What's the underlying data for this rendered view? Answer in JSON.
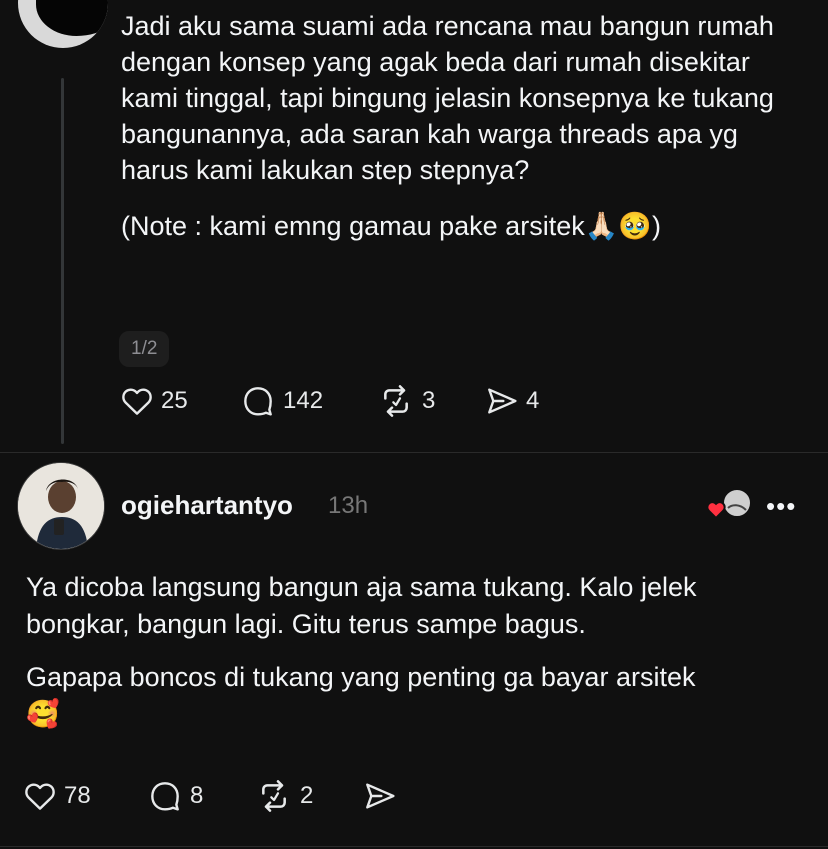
{
  "original_post": {
    "paragraph_1": "Jadi aku sama suami ada rencana mau bangun rumah dengan konsep yang agak beda dari rumah disekitar kami tinggal, tapi bingung jelasin konsepnya ke tukang bangunannya, ada saran kah warga threads apa yg harus kami lakukan step stepnya?",
    "paragraph_2_text": "(Note : kami emng gamau pake arsitek",
    "paragraph_2_emoji": "🙏🏻🥹",
    "paragraph_2_close": ")",
    "page_indicator": "1/2",
    "likes": "25",
    "comments": "142",
    "reposts": "3",
    "shares": "4"
  },
  "reply": {
    "username": "ogiehartantyo",
    "time": "13h",
    "paragraph_1": "Ya dicoba langsung bangun aja sama tukang. Kalo jelek bongkar, bangun lagi. Gitu terus sampe bagus.",
    "paragraph_2": "Gapapa boncos di tukang yang penting ga bayar arsitek",
    "paragraph_2_emoji": "🥰",
    "likes": "78",
    "comments": "8",
    "reposts": "2",
    "more_label": "•••"
  },
  "colors": {
    "background": "#101010",
    "text": "#f3f5f7",
    "muted": "#777777",
    "heart_red": "#ff3040"
  },
  "icons": [
    "heart-icon",
    "comment-icon",
    "repost-icon",
    "share-icon",
    "more-icon"
  ]
}
